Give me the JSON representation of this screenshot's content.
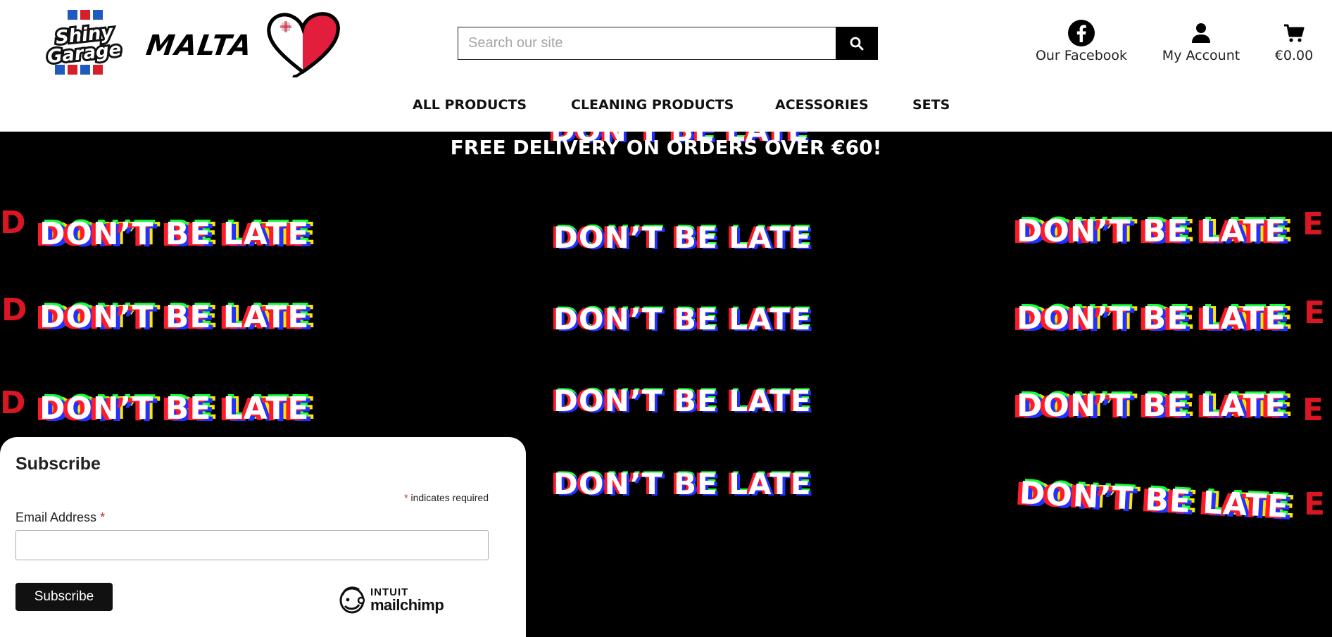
{
  "brand": {
    "logo_name": "Shiny Garage",
    "logo_line1": "Shiny",
    "logo_line2": "Garage",
    "country": "MALTA",
    "colors": {
      "blue": "#1f5bbf",
      "red": "#d71f2a",
      "malta_red": "#e31d3c"
    }
  },
  "search": {
    "placeholder": "Search our site",
    "button_icon": "search-icon"
  },
  "utility": {
    "facebook": {
      "label": "Our Facebook",
      "icon": "facebook-icon"
    },
    "account": {
      "label": "My Account",
      "icon": "user-icon"
    },
    "cart": {
      "label": "€0.00",
      "icon": "cart-icon"
    }
  },
  "nav": {
    "items": [
      {
        "label": "ALL PRODUCTS"
      },
      {
        "label": "CLEANING PRODUCTS"
      },
      {
        "label": "ACESSORIES"
      },
      {
        "label": "SETS"
      }
    ]
  },
  "hero": {
    "promo": "FREE DELIVERY ON ORDERS OVER €60!",
    "slogan": "DON’T BE LATE",
    "slogan_alt": "DON’T BE LATE",
    "ghost_prefix": "D",
    "ghost_suffix": "E"
  },
  "subscribe": {
    "title": "Subscribe",
    "required_note": "indicates required",
    "required_star": "*",
    "email_label": "Email Address",
    "email_value": "",
    "button": "Subscribe",
    "mailchimp_top": "INTUIT",
    "mailchimp_word": "mailchimp"
  }
}
